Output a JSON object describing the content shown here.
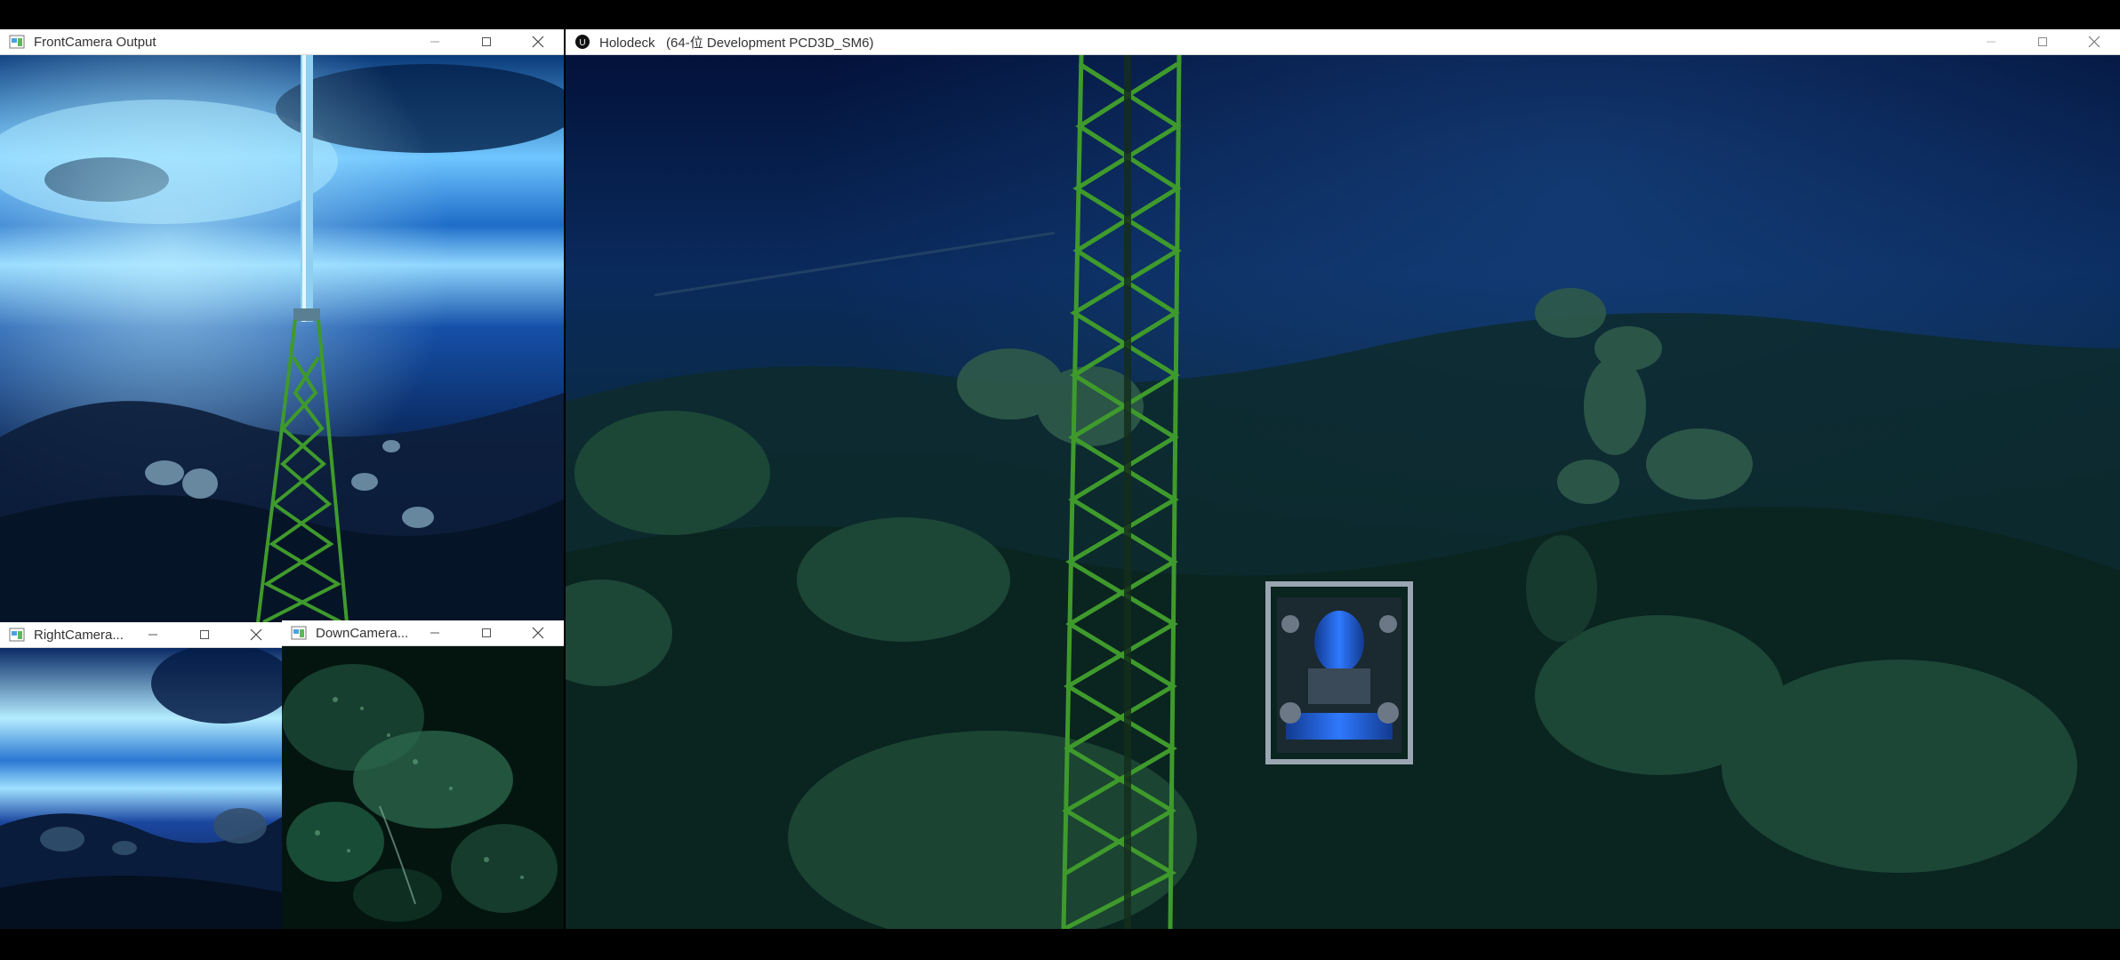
{
  "windows": {
    "front_camera": {
      "title": "FrontCamera Output"
    },
    "right_camera": {
      "title": "RightCamera..."
    },
    "down_camera": {
      "title": "DownCamera..."
    },
    "holodeck": {
      "title": "Holodeck   (64-位 Development PCD3D_SM6)"
    }
  },
  "icons": {
    "opencv_window": "opencv-window-icon",
    "unreal_app": "unreal-engine-icon",
    "minimize": "minimize-icon",
    "maximize": "maximize-icon",
    "close": "close-icon"
  },
  "colors": {
    "titlebar": "#ffffff",
    "water_deep": "#03123a",
    "water_surface": "#6fc6ff",
    "tower_green": "#3f9a2c",
    "rov_blue": "#1f5fd6"
  }
}
